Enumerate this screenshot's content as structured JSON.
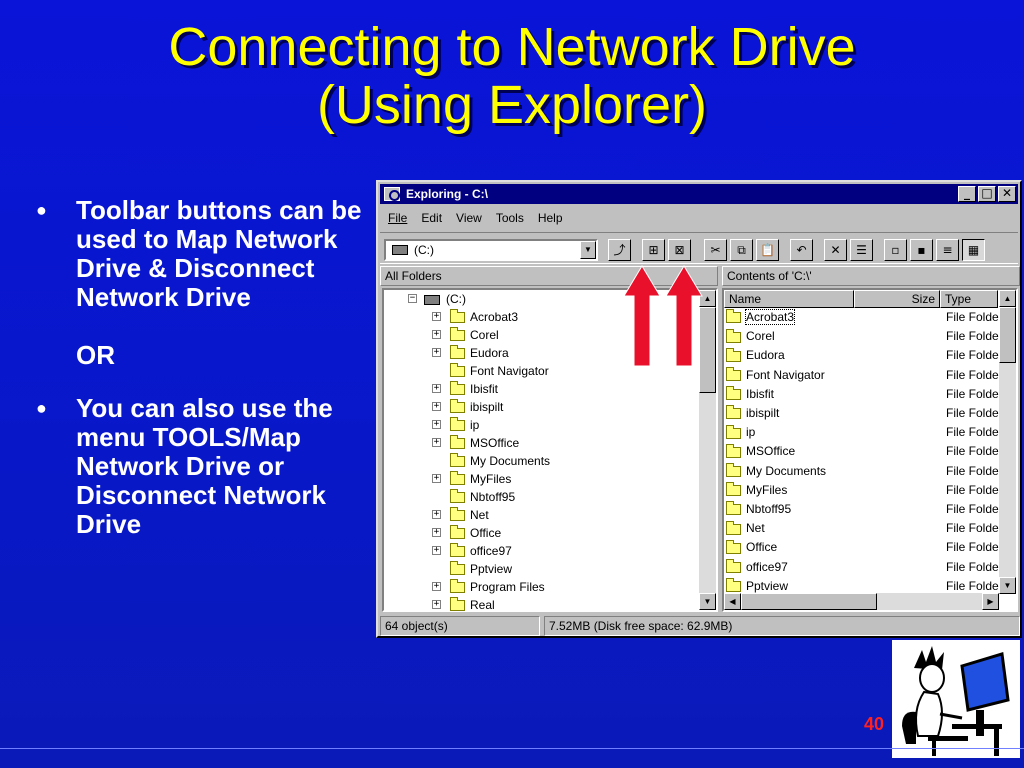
{
  "slide": {
    "title_line1": "Connecting to Network Drive",
    "title_line2": "(Using Explorer)",
    "bullet1": "Toolbar buttons can be used to Map Network Drive & Disconnect Network Drive",
    "or": "OR",
    "bullet2": "You can also use the menu TOOLS/Map Network Drive or Disconnect Network Drive",
    "page_number": "40"
  },
  "window": {
    "title": "Exploring - C:\\",
    "menu": [
      "File",
      "Edit",
      "View",
      "Tools",
      "Help"
    ],
    "address": "(C:)",
    "left_header": "All Folders",
    "right_header": "Contents of 'C:\\'",
    "tree_root": "(C:)",
    "tree": [
      "Acrobat3",
      "Corel",
      "Eudora",
      "Font Navigator",
      "Ibisfit",
      "ibispilt",
      "ip",
      "MSOffice",
      "My Documents",
      "MyFiles",
      "Nbtoff95",
      "Net",
      "Office",
      "office97",
      "Pptview",
      "Program Files",
      "Real"
    ],
    "columns": {
      "name": "Name",
      "size": "Size",
      "type": "Type"
    },
    "files": [
      "Acrobat3",
      "Corel",
      "Eudora",
      "Font Navigator",
      "Ibisfit",
      "ibispilt",
      "ip",
      "MSOffice",
      "My Documents",
      "MyFiles",
      "Nbtoff95",
      "Net",
      "Office",
      "office97",
      "Pptview"
    ],
    "file_type": "File Folder",
    "status_objects": "64 object(s)",
    "status_disk": "7.52MB (Disk free space: 62.9MB)"
  },
  "colors": {
    "background": "#0a14d8",
    "title": "#ffff00",
    "arrow": "#e8102a",
    "titlebar": "#000080"
  }
}
